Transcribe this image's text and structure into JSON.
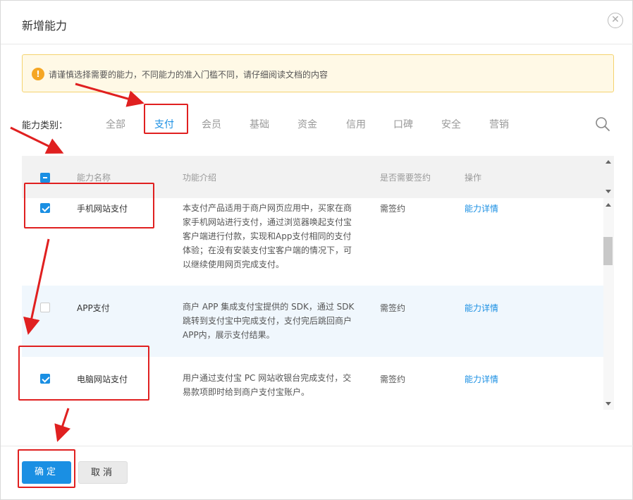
{
  "dialog": {
    "title": "新增能力",
    "close_icon": "close-circle-icon"
  },
  "notice": {
    "icon": "warning-icon",
    "icon_glyph": "!",
    "text": "请谨慎选择需要的能力，不同能力的准入门槛不同，请仔细阅读文档的内容"
  },
  "categories": {
    "label": "能力类别：",
    "tabs": [
      "全部",
      "支付",
      "会员",
      "基础",
      "资金",
      "信用",
      "口碑",
      "安全",
      "营销"
    ],
    "active": "支付",
    "search_icon": "search-icon"
  },
  "table": {
    "headers": {
      "name": "能力名称",
      "desc": "功能介绍",
      "sign": "是否需要签约",
      "op": "操作"
    },
    "select_all_state": "partial",
    "rows": [
      {
        "checked": true,
        "name": "手机网站支付",
        "desc": "本支付产品适用于商户网页应用中，买家在商家手机网站进行支付，通过浏览器唤起支付宝客户端进行付款，实现和App支付相同的支付体验；在没有安装支付宝客户端的情况下，可以继续使用网页完成支付。",
        "sign": "需签约",
        "op": "能力详情"
      },
      {
        "checked": false,
        "name": "APP支付",
        "desc": "商户 APP 集成支付宝提供的 SDK，通过 SDK 跳转到支付宝中完成支付，支付完后跳回商户APP内，展示支付结果。",
        "sign": "需签约",
        "op": "能力详情"
      },
      {
        "checked": true,
        "name": "电脑网站支付",
        "desc": "用户通过支付宝 PC 网站收银台完成支付，交易款项即时给到商户支付宝账户。",
        "sign": "需签约",
        "op": "能力详情"
      }
    ]
  },
  "footer": {
    "ok": "确定",
    "cancel": "取消"
  },
  "colors": {
    "accent": "#1a8fe3",
    "annotation": "#e02020",
    "notice_bg": "#fff9e6",
    "row_highlight": "#f0f7fd"
  }
}
